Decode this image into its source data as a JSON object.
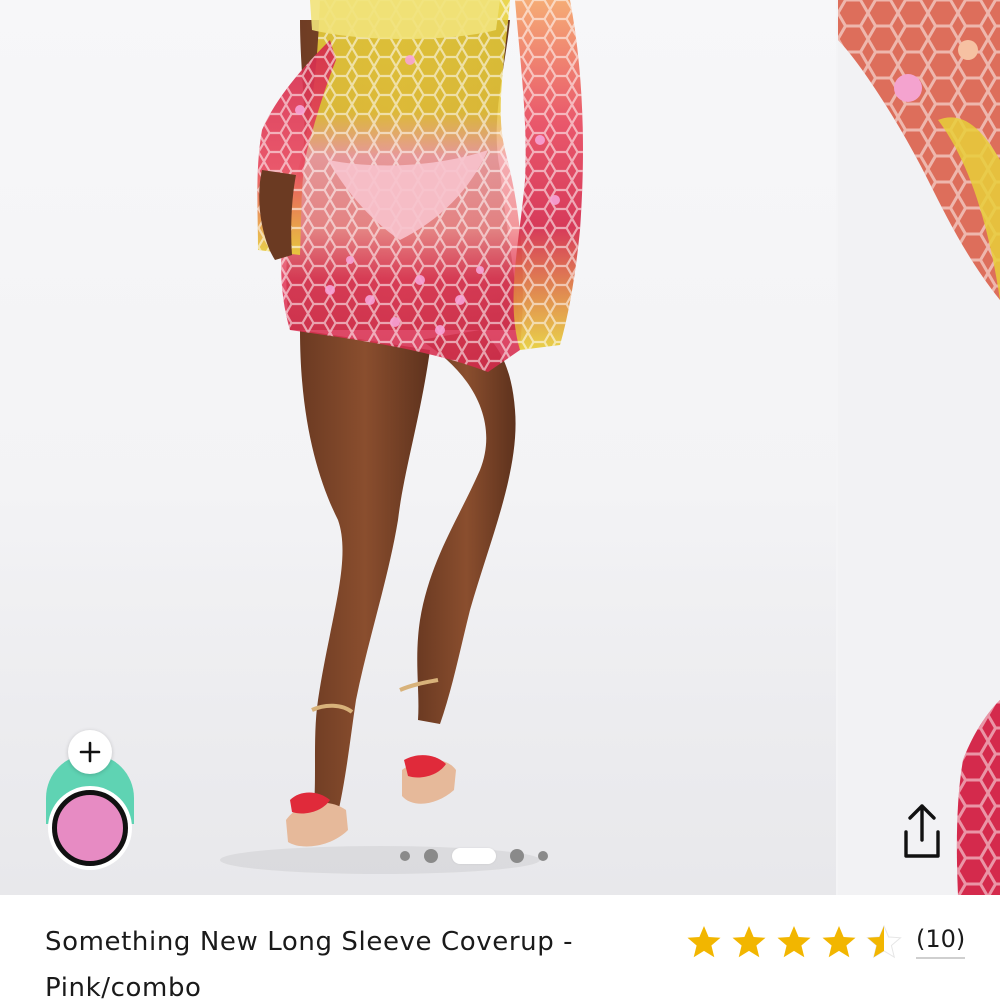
{
  "product": {
    "title": "Something New Long Sleeve Coverup - Pink/combo",
    "rating": 4.5,
    "review_count_label": "(10)"
  },
  "gallery": {
    "slide_count": 5,
    "active_index": 2
  },
  "quick_add": {
    "add_icon": "plus-icon",
    "swatch_color": "#e78bc3",
    "accent_color": "#5fd3b3"
  },
  "actions": {
    "share_icon": "share-icon"
  },
  "colors": {
    "star": "#f2b600",
    "text": "#1a1a1a"
  }
}
